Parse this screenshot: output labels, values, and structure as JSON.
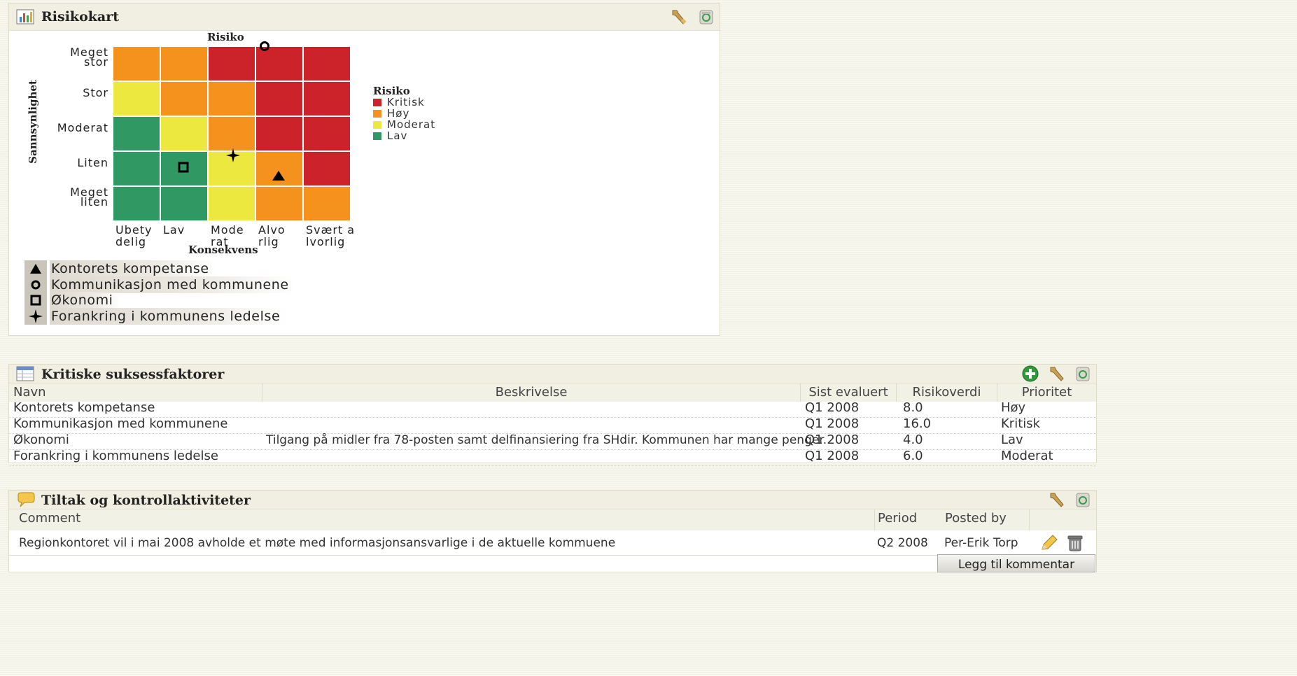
{
  "risk_panel": {
    "title": "Risikokart",
    "title_icon": "chart-icon",
    "tools": [
      "wrench-icon",
      "recycle-bin-icon"
    ],
    "chart_data": {
      "type": "heatmap",
      "title": "Risiko",
      "xlabel": "Konsekvens",
      "ylabel": "Sannsynlighet",
      "x_categories": [
        [
          "Ubety",
          "delig"
        ],
        [
          "Lav"
        ],
        [
          "Mode",
          "rat"
        ],
        [
          "Alvo",
          "rlig"
        ],
        [
          "Svært a",
          "lvorlig"
        ]
      ],
      "y_categories": [
        [
          "Meget",
          "stor"
        ],
        [
          "Stor"
        ],
        [
          "Moderat"
        ],
        [
          "Liten"
        ],
        [
          "Meget",
          "liten"
        ]
      ],
      "levels": [
        "Kritisk",
        "Høy",
        "Moderat",
        "Lav"
      ],
      "level_colors": {
        "Kritisk": "#cc2229",
        "Høy": "#f5921e",
        "Moderat": "#ede840",
        "Lav": "#2f9863"
      },
      "grid": [
        [
          "Høy",
          "Høy",
          "Kritisk",
          "Kritisk",
          "Kritisk"
        ],
        [
          "Moderat",
          "Høy",
          "Høy",
          "Kritisk",
          "Kritisk"
        ],
        [
          "Lav",
          "Moderat",
          "Høy",
          "Kritisk",
          "Kritisk"
        ],
        [
          "Lav",
          "Lav",
          "Moderat",
          "Høy",
          "Kritisk"
        ],
        [
          "Lav",
          "Lav",
          "Moderat",
          "Høy",
          "Høy"
        ]
      ],
      "legend_title": "Risiko",
      "legend": [
        "Kritisk",
        "Høy",
        "Moderat",
        "Lav"
      ],
      "markers": [
        {
          "name": "Kontorets kompetanse",
          "symbol": "triangle",
          "konsekvens": "Alvo rlig",
          "sannsynlighet": "Liten"
        },
        {
          "name": "Kommunikasjon med kommunene",
          "symbol": "circle",
          "konsekvens": "Alvo rlig",
          "sannsynlighet": "Meget stor"
        },
        {
          "name": "Økonomi",
          "symbol": "square",
          "konsekvens": "Lav",
          "sannsynlighet": "Liten"
        },
        {
          "name": "Forankring i kommunens ledelse",
          "symbol": "star",
          "konsekvens": "Mode rat",
          "sannsynlighet": "Liten"
        }
      ]
    }
  },
  "csf_panel": {
    "title": "Kritiske suksessfaktorer",
    "title_icon": "table-icon",
    "tools": [
      "add-icon",
      "wrench-icon",
      "recycle-bin-icon"
    ],
    "columns": [
      "Navn",
      "Beskrivelse",
      "Sist evaluert",
      "Risikoverdi",
      "Prioritet"
    ],
    "rows": [
      [
        "Kontorets kompetanse",
        "",
        "Q1 2008",
        "8.0",
        "Høy"
      ],
      [
        "Kommunikasjon med kommunene",
        "",
        "Q1 2008",
        "16.0",
        "Kritisk"
      ],
      [
        "Økonomi",
        "Tilgang på midler fra 78-posten samt delfinansiering fra SHdir. Kommunen har mange penger.",
        "Q1 2008",
        "4.0",
        "Lav"
      ],
      [
        "Forankring i kommunens ledelse",
        "",
        "Q1 2008",
        "6.0",
        "Moderat"
      ]
    ]
  },
  "tiltak_panel": {
    "title": "Tiltak og kontrollaktiviteter",
    "title_icon": "speech-bubble-icon",
    "tools": [
      "wrench-icon",
      "recycle-bin-icon"
    ],
    "columns": [
      "Comment",
      "Period",
      "Posted by"
    ],
    "rows": [
      [
        "Regionkontoret vil i mai 2008 avholde et møte med informasjonsansvarlige i de aktuelle kommuene",
        "Q2 2008",
        "Per-Erik Torp"
      ]
    ],
    "row_actions": [
      "edit-pencil-icon",
      "trash-icon"
    ],
    "add_button": "Legg til kommentar"
  }
}
